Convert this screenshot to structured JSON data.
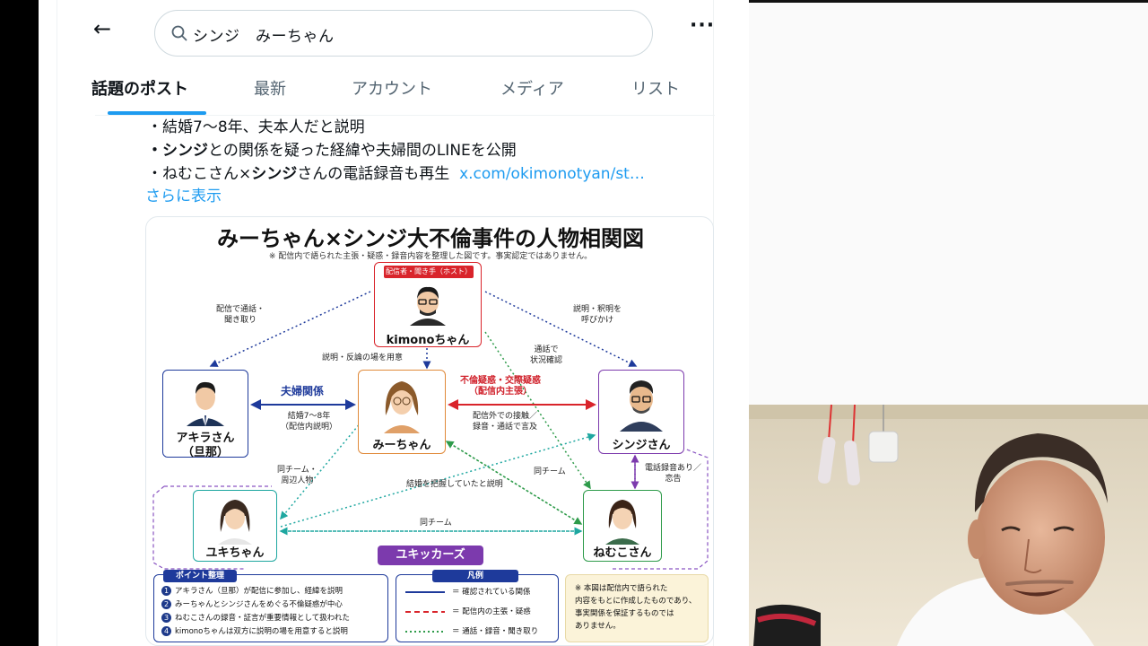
{
  "search": {
    "query": "シンジ　みーちゃん"
  },
  "tabs": [
    {
      "label": "話題のポスト"
    },
    {
      "label": "最新"
    },
    {
      "label": "アカウント"
    },
    {
      "label": "メディア"
    },
    {
      "label": "リスト"
    }
  ],
  "post": {
    "line1": "・結婚7〜8年、夫本人だと説明",
    "line2_bold": "・シンジ",
    "line2_rest": "との関係を疑った経緯や夫婦間のLINEを公開",
    "line3_a": "・ねむこさん×",
    "line3_bold": "シンジ",
    "line3_b": "さんの電話録音も再生",
    "line3_link": "x.com/okimonotyan/st…",
    "show_more": "さらに表示"
  },
  "infographic": {
    "title": "みーちゃん×シンジ大不倫事件の人物相関図",
    "note": "※ 配信内で語られた主張・疑惑・録音内容を整理した図です。事実認定ではありません。",
    "host_tag": "配信者・聞き手（ホスト）",
    "nodes": {
      "host": "kimonoちゃん",
      "akira_1": "アキラさん",
      "akira_2": "（旦那）",
      "mii": "みーちゃん",
      "shinji": "シンジさん",
      "yuki": "ユキちゃん",
      "nemuko": "ねむこさん"
    },
    "labels": {
      "call_listen_1": "配信で通話・",
      "call_listen_2": "聞き取り",
      "explain_1": "説明・釈明を",
      "explain_2": "呼びかけ",
      "call_check_1": "通話で",
      "call_check_2": "状況確認",
      "place": "説明・反論の場を用意",
      "couple": "夫婦関係",
      "married_1": "結婚7〜8年",
      "married_2": "（配信内説明）",
      "affair_1": "不倫疑惑・交際疑惑",
      "affair_2": "（配信内主張）",
      "contact_1": "配信外での接触／",
      "contact_2": "録音・通話で言及",
      "recording_1": "電話録音あり／",
      "recording_2": "恋告",
      "team_side_1": "同チーム・",
      "team_side_2": "周辺人物",
      "aware": "結婚を把握していたと説明",
      "team_a": "同チーム",
      "team_b": "同チーム"
    },
    "group_tag": "ユキッカーズ",
    "points": {
      "head": "ポイント整理",
      "items": [
        {
          "n": "1",
          "text": "アキラさん（旦那）が配信に参加し、経緯を説明"
        },
        {
          "n": "2",
          "text": "みーちゃんとシンジさんをめぐる不倫疑惑が中心"
        },
        {
          "n": "3",
          "text": "ねむこさんの録音・証言が重要情報として扱われた"
        },
        {
          "n": "4",
          "text": "kimonoちゃんは双方に説明の場を用意すると説明"
        }
      ]
    },
    "legend": {
      "head": "凡例",
      "items": [
        {
          "text": "＝ 確認されている関係"
        },
        {
          "text": "＝ 配信内の主張・疑惑"
        },
        {
          "text": "＝ 通話・録音・聞き取り"
        }
      ]
    },
    "disclaimer": {
      "line1": "※ 本図は配信内で語られた",
      "line2": "内容をもとに作成したものであり、",
      "line3": "事実関係を保証するものでは",
      "line4": "ありません。"
    }
  },
  "colors": {
    "accent": "#1d9bf0",
    "confirmed": "#1e3a9b",
    "claim": "#d9242b",
    "call": "#2e9b4a",
    "group": "#7c3aad"
  }
}
